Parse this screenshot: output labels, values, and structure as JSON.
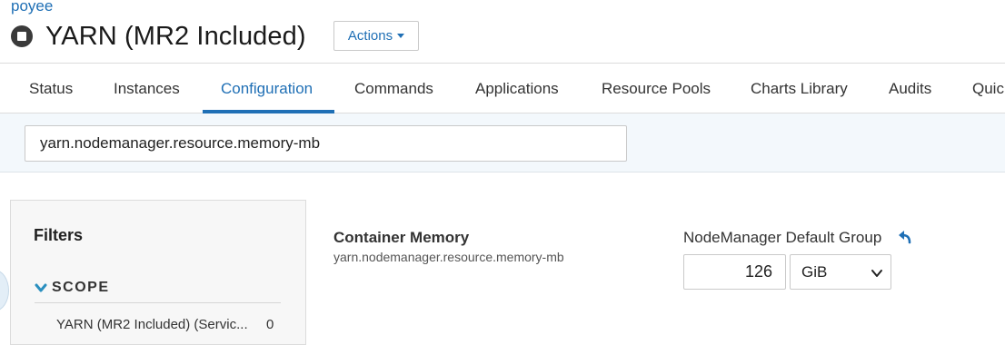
{
  "breadcrumb": "poyee",
  "header": {
    "title": "YARN (MR2 Included)",
    "status_icon": "stop-icon",
    "actions_label": "Actions"
  },
  "nav": {
    "active_tab": "Configuration",
    "accent_color": "#1f6fb5",
    "tabs": [
      {
        "label": "Status"
      },
      {
        "label": "Instances"
      },
      {
        "label": "Configuration"
      },
      {
        "label": "Commands"
      },
      {
        "label": "Applications"
      },
      {
        "label": "Resource Pools"
      },
      {
        "label": "Charts Library"
      },
      {
        "label": "Audits"
      },
      {
        "label": "Quic"
      }
    ]
  },
  "search": {
    "value": "yarn.nodemanager.resource.memory-mb"
  },
  "filters": {
    "title": "Filters",
    "scope_label": "SCOPE",
    "scope_expanded": true,
    "items": [
      {
        "label": "YARN (MR2 Included) (Servic...",
        "count": "0"
      }
    ]
  },
  "config": {
    "name": "Container Memory",
    "key": "yarn.nodemanager.resource.memory-mb",
    "group_label": "NodeManager Default Group",
    "undo_icon": "undo-icon",
    "value": "126",
    "unit": "GiB"
  }
}
